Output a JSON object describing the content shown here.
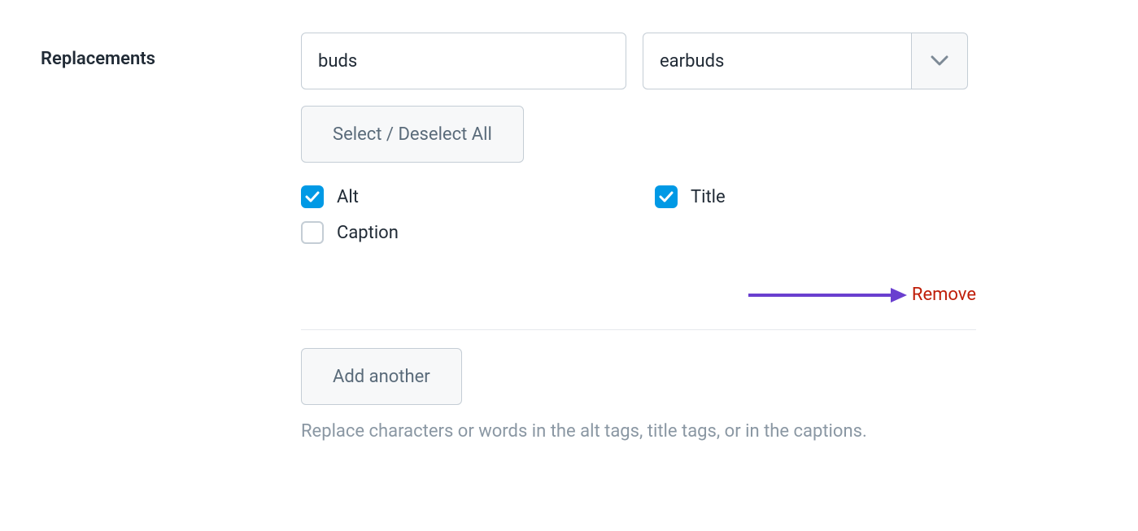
{
  "section": {
    "label": "Replacements"
  },
  "inputs": {
    "from_value": "buds",
    "to_value": "earbuds"
  },
  "buttons": {
    "select_all": "Select / Deselect All",
    "add_another": "Add another",
    "remove": "Remove"
  },
  "checkboxes": {
    "alt": {
      "label": "Alt",
      "checked": true
    },
    "title": {
      "label": "Title",
      "checked": true
    },
    "caption": {
      "label": "Caption",
      "checked": false
    }
  },
  "help": "Replace characters or words in the alt tags, title tags, or in the captions.",
  "colors": {
    "checkbox_checked": "#0099e5",
    "remove_link": "#bf1d08",
    "arrow": "#6a3fcf"
  }
}
